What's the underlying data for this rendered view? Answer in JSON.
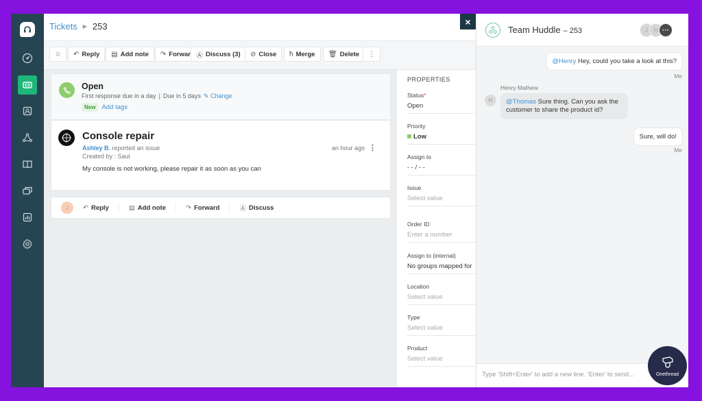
{
  "breadcrumb": {
    "parent": "Tickets",
    "current": "253"
  },
  "toolbar": {
    "star_icon": "star-icon",
    "buttons": [
      {
        "label": "Reply",
        "icon": "reply-icon"
      },
      {
        "label": "Add note",
        "icon": "note-icon"
      },
      {
        "label": "Forward",
        "icon": "forward-icon"
      },
      {
        "label": "Discuss (3)",
        "icon": "discuss-icon"
      },
      {
        "label": "Close",
        "icon": "check-circle-icon"
      },
      {
        "label": "Merge",
        "icon": "merge-icon"
      },
      {
        "label": "Delete",
        "icon": "trash-icon"
      }
    ],
    "more_icon": "kebab-icon"
  },
  "sidebar": {
    "items": [
      {
        "name": "dashboard",
        "icon": "gauge-icon"
      },
      {
        "name": "tickets",
        "icon": "ticket-icon",
        "active": true
      },
      {
        "name": "contacts",
        "icon": "contact-icon"
      },
      {
        "name": "groups",
        "icon": "network-icon"
      },
      {
        "name": "solutions",
        "icon": "book-icon"
      },
      {
        "name": "conversations",
        "icon": "chat-icon"
      },
      {
        "name": "reports",
        "icon": "chart-icon"
      },
      {
        "name": "settings",
        "icon": "gear-icon"
      }
    ]
  },
  "status": {
    "title": "Open",
    "first_response": "First response due in a day",
    "separator": "|",
    "due": "Due in 5 days",
    "change_label": "Change",
    "badge": "New",
    "add_tags": "Add tags"
  },
  "ticket": {
    "title": "Console repair",
    "reporter": "Ashley B.",
    "reported_text": "reported an issue",
    "created_by": "Created by : Saul",
    "time": "an hour ago",
    "body": "My console is not working, please repair it as soon as you can"
  },
  "reply_bar": {
    "avatar_initial": "J",
    "buttons": [
      {
        "label": "Reply",
        "icon": "reply-icon"
      },
      {
        "label": "Add note",
        "icon": "note-icon"
      },
      {
        "label": "Forward",
        "icon": "forward-icon"
      },
      {
        "label": "Discuss",
        "icon": "discuss-icon"
      }
    ]
  },
  "properties": {
    "title": "PROPERTIES",
    "fields": [
      {
        "label": "Status",
        "value": "Open",
        "required": true,
        "placeholder": false
      },
      {
        "label": "Priority",
        "value": "Low",
        "placeholder": false,
        "color": "#8fcd6c"
      },
      {
        "label": "Assign to",
        "value": "- - / - -",
        "placeholder": false
      },
      {
        "label": "Issue",
        "value": "Select value",
        "placeholder": true
      },
      {
        "label": "Order ID",
        "value": "Enter a number",
        "placeholder": true
      },
      {
        "label": "Assign to (internal)",
        "value": "No groups mapped for",
        "placeholder": false
      },
      {
        "label": "Location",
        "value": "Select value",
        "placeholder": true
      },
      {
        "label": "Type",
        "value": "Select value",
        "placeholder": true
      },
      {
        "label": "Product",
        "value": "Select value",
        "placeholder": true
      }
    ]
  },
  "huddle": {
    "title": "Team Huddle",
    "ticket_num": "– 253",
    "avatars": [
      "J",
      "H"
    ],
    "more": "···",
    "messages": [
      {
        "from": "me",
        "mention": "@Henry",
        "text": " Hey, could you take a look at this?",
        "label": "Me"
      },
      {
        "from": "Henry Mathew",
        "initial": "H",
        "mention": "@Thomas",
        "text": " Sure thing. Can you ask the customer to share the product id?"
      },
      {
        "from": "me",
        "mention": "",
        "text": "Sure, will do!",
        "label": "Me"
      }
    ],
    "composer_placeholder": "Type 'Shift+Enter' to add a new line. 'Enter' to send..."
  },
  "close_label": "×",
  "watermark": {
    "text": "Onethread"
  },
  "colors": {
    "accent": "#1fb67a",
    "link": "#3f8fcf",
    "sidebar": "#264553",
    "background": "#8512df"
  }
}
